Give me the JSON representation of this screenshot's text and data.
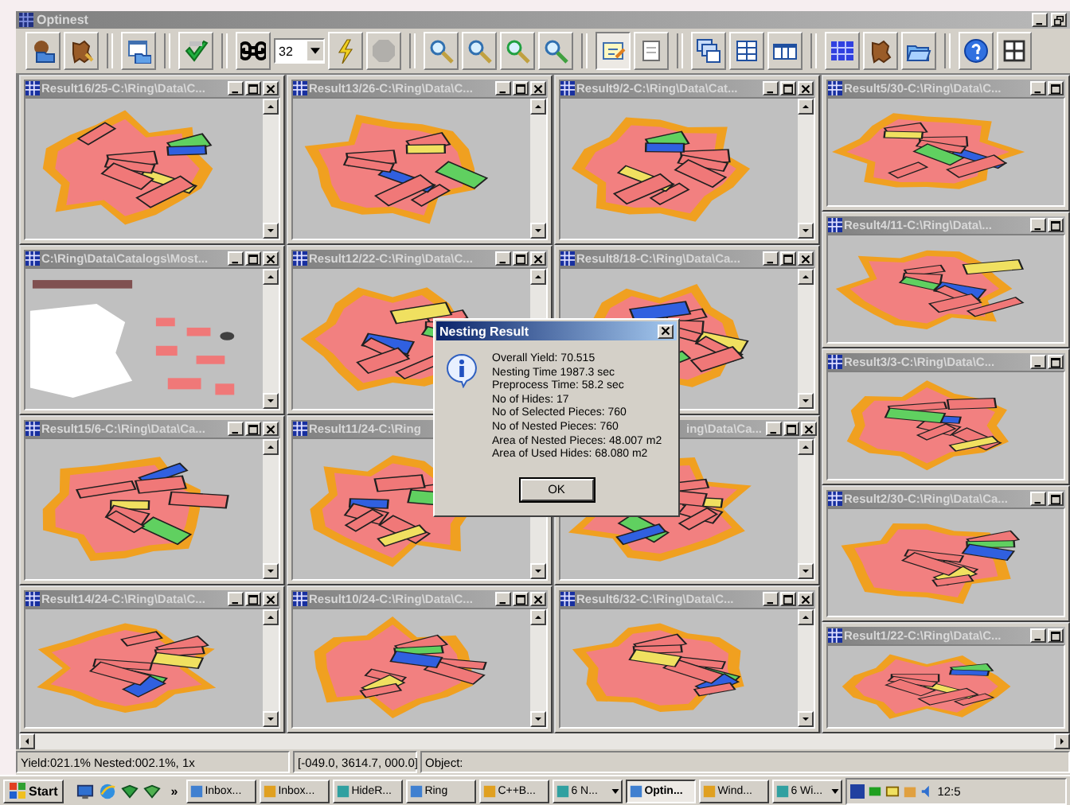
{
  "window": {
    "title": "Optinest"
  },
  "toolbar": [
    {
      "kind": "button",
      "pressed": false,
      "disabled": false
    },
    {
      "kind": "button",
      "pressed": false,
      "disabled": false
    },
    {
      "kind": "button",
      "pressed": false,
      "disabled": false
    },
    {
      "kind": "button",
      "pressed": false,
      "disabled": false
    },
    {
      "kind": "button",
      "pressed": false,
      "disabled": false
    },
    {
      "kind": "combo",
      "value": "32"
    },
    {
      "kind": "button",
      "pressed": false,
      "disabled": false
    },
    {
      "kind": "button",
      "pressed": false,
      "disabled": true
    },
    {
      "kind": "button",
      "pressed": false,
      "disabled": false
    },
    {
      "kind": "button",
      "pressed": false,
      "disabled": false
    },
    {
      "kind": "button",
      "pressed": false,
      "disabled": false
    },
    {
      "kind": "button",
      "pressed": false,
      "disabled": false
    },
    {
      "kind": "button",
      "pressed": true,
      "disabled": false
    },
    {
      "kind": "button",
      "pressed": false,
      "disabled": false
    },
    {
      "kind": "button",
      "pressed": false,
      "disabled": false
    },
    {
      "kind": "button",
      "pressed": false,
      "disabled": false
    },
    {
      "kind": "button",
      "pressed": false,
      "disabled": false
    },
    {
      "kind": "button",
      "pressed": false,
      "disabled": false
    },
    {
      "kind": "button",
      "pressed": false,
      "disabled": false
    },
    {
      "kind": "button",
      "pressed": false,
      "disabled": false
    },
    {
      "kind": "button",
      "pressed": false,
      "disabled": false
    },
    {
      "kind": "button",
      "pressed": false,
      "disabled": false
    }
  ],
  "columns": [
    {
      "cut_off": false,
      "windows": [
        {
          "title": "Result16/25-C:\\Ring\\Data\\C...",
          "kind": "nesting",
          "title_cut_start": false
        },
        {
          "title": "C:\\Ring\\Data\\Catalogs\\Most...",
          "kind": "catalog",
          "title_cut_start": false
        },
        {
          "title": "Result15/6-C:\\Ring\\Data\\Ca...",
          "kind": "nesting",
          "title_cut_start": false
        },
        {
          "title": "Result14/24-C:\\Ring\\Data\\C...",
          "kind": "nesting",
          "title_cut_start": false
        }
      ]
    },
    {
      "cut_off": false,
      "windows": [
        {
          "title": "Result13/26-C:\\Ring\\Data\\C...",
          "kind": "nesting",
          "title_cut_start": false
        },
        {
          "title": "Result12/22-C:\\Ring\\Data\\C...",
          "kind": "nesting",
          "title_cut_start": false
        },
        {
          "title": "Result11/24-C:\\Ring",
          "kind": "nesting",
          "title_cut_start": false
        },
        {
          "title": "Result10/24-C:\\Ring\\Data\\C...",
          "kind": "nesting",
          "title_cut_start": false
        }
      ]
    },
    {
      "cut_off": false,
      "windows": [
        {
          "title": "Result9/2-C:\\Ring\\Data\\Cat...",
          "kind": "nesting",
          "title_cut_start": false
        },
        {
          "title": "Result8/18-C:\\Ring\\Data\\Ca...",
          "kind": "nesting",
          "title_cut_start": false
        },
        {
          "title": "ing\\Data\\Ca...",
          "kind": "nesting",
          "title_cut_start": true
        },
        {
          "title": "Result6/32-C:\\Ring\\Data\\C...",
          "kind": "nesting",
          "title_cut_start": false
        }
      ]
    },
    {
      "cut_off": true,
      "windows": [
        {
          "title": "Result5/30-C:\\Ring\\Data\\C...",
          "kind": "nesting",
          "title_cut_start": false
        },
        {
          "title": "Result4/11-C:\\Ring\\Data\\...",
          "kind": "nesting",
          "title_cut_start": false
        },
        {
          "title": "Result3/3-C:\\Ring\\Data\\C...",
          "kind": "nesting",
          "title_cut_start": false
        },
        {
          "title": "Result2/30-C:\\Ring\\Data\\Ca...",
          "kind": "nesting",
          "title_cut_start": false
        },
        {
          "title": "Result1/22-C:\\Ring\\Data\\C...",
          "kind": "nesting",
          "title_cut_start": false
        }
      ]
    }
  ],
  "dialog": {
    "title": "Nesting Result",
    "lines": [
      "Overall Yield: 70.515",
      "Nesting Time 1987.3 sec",
      "Preprocess Time: 58.2 sec",
      "No of Hides: 17",
      "No of Selected Pieces: 760",
      "No of Nested Pieces: 760",
      "Area of Nested Pieces: 48.007 m2",
      "Area of Used Hides: 68.080 m2"
    ],
    "button": "OK"
  },
  "status_bar": {
    "yield": "Yield:021.1% Nested:002.1%, 1x",
    "coordinates": "[-049.0, 3614.7, 000.0]",
    "object": "Object:"
  },
  "taskbar": {
    "start": "Start",
    "overflow": "»",
    "tasks": [
      {
        "label": "Inbox...",
        "selected": false,
        "grouped": false
      },
      {
        "label": "Inbox...",
        "selected": false,
        "grouped": false
      },
      {
        "label": "HideR...",
        "selected": false,
        "grouped": false
      },
      {
        "label": "Ring",
        "selected": false,
        "grouped": false
      },
      {
        "label": "C++B...",
        "selected": false,
        "grouped": false
      },
      {
        "label": "6 N...",
        "selected": false,
        "grouped": true
      },
      {
        "label": "Optin...",
        "selected": true,
        "grouped": false
      },
      {
        "label": "Wind...",
        "selected": false,
        "grouped": false
      },
      {
        "label": "6 Wi...",
        "selected": false,
        "grouped": true
      }
    ],
    "clock": "12:5"
  }
}
